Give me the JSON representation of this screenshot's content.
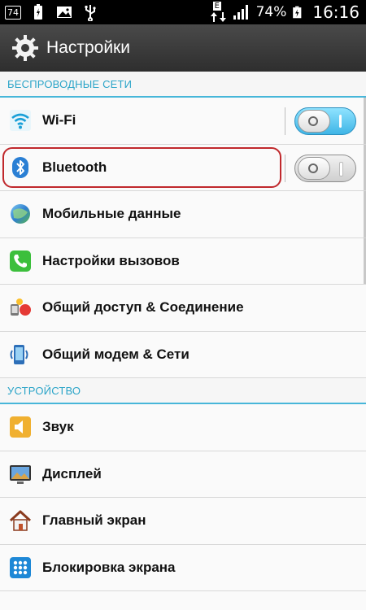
{
  "status_bar": {
    "badge": "74",
    "signal_letter": "E",
    "battery": "74%",
    "time": "16:16"
  },
  "header": {
    "title": "Настройки"
  },
  "sections": [
    {
      "header": "БЕСПРОВОДНЫЕ СЕТИ",
      "items": [
        {
          "label": "Wi-Fi",
          "icon": "wifi-icon",
          "toggle": "on"
        },
        {
          "label": "Bluetooth",
          "icon": "bluetooth-icon",
          "toggle": "off",
          "highlighted": true
        },
        {
          "label": "Мобильные данные",
          "icon": "mobile-data-icon"
        },
        {
          "label": "Настройки вызовов",
          "icon": "phone-icon"
        },
        {
          "label": "Общий доступ & Соединение",
          "icon": "share-icon"
        },
        {
          "label": "Общий модем & Сети",
          "icon": "tethering-icon"
        }
      ]
    },
    {
      "header": "УСТРОЙСТВО",
      "items": [
        {
          "label": "Звук",
          "icon": "speaker-icon"
        },
        {
          "label": "Дисплей",
          "icon": "display-icon"
        },
        {
          "label": "Главный экран",
          "icon": "home-icon"
        },
        {
          "label": "Блокировка экрана",
          "icon": "lock-screen-icon"
        }
      ]
    }
  ],
  "colors": {
    "accent": "#2aa4c8",
    "toggle_on": "#3fb5e6",
    "highlight": "#c0282c"
  }
}
